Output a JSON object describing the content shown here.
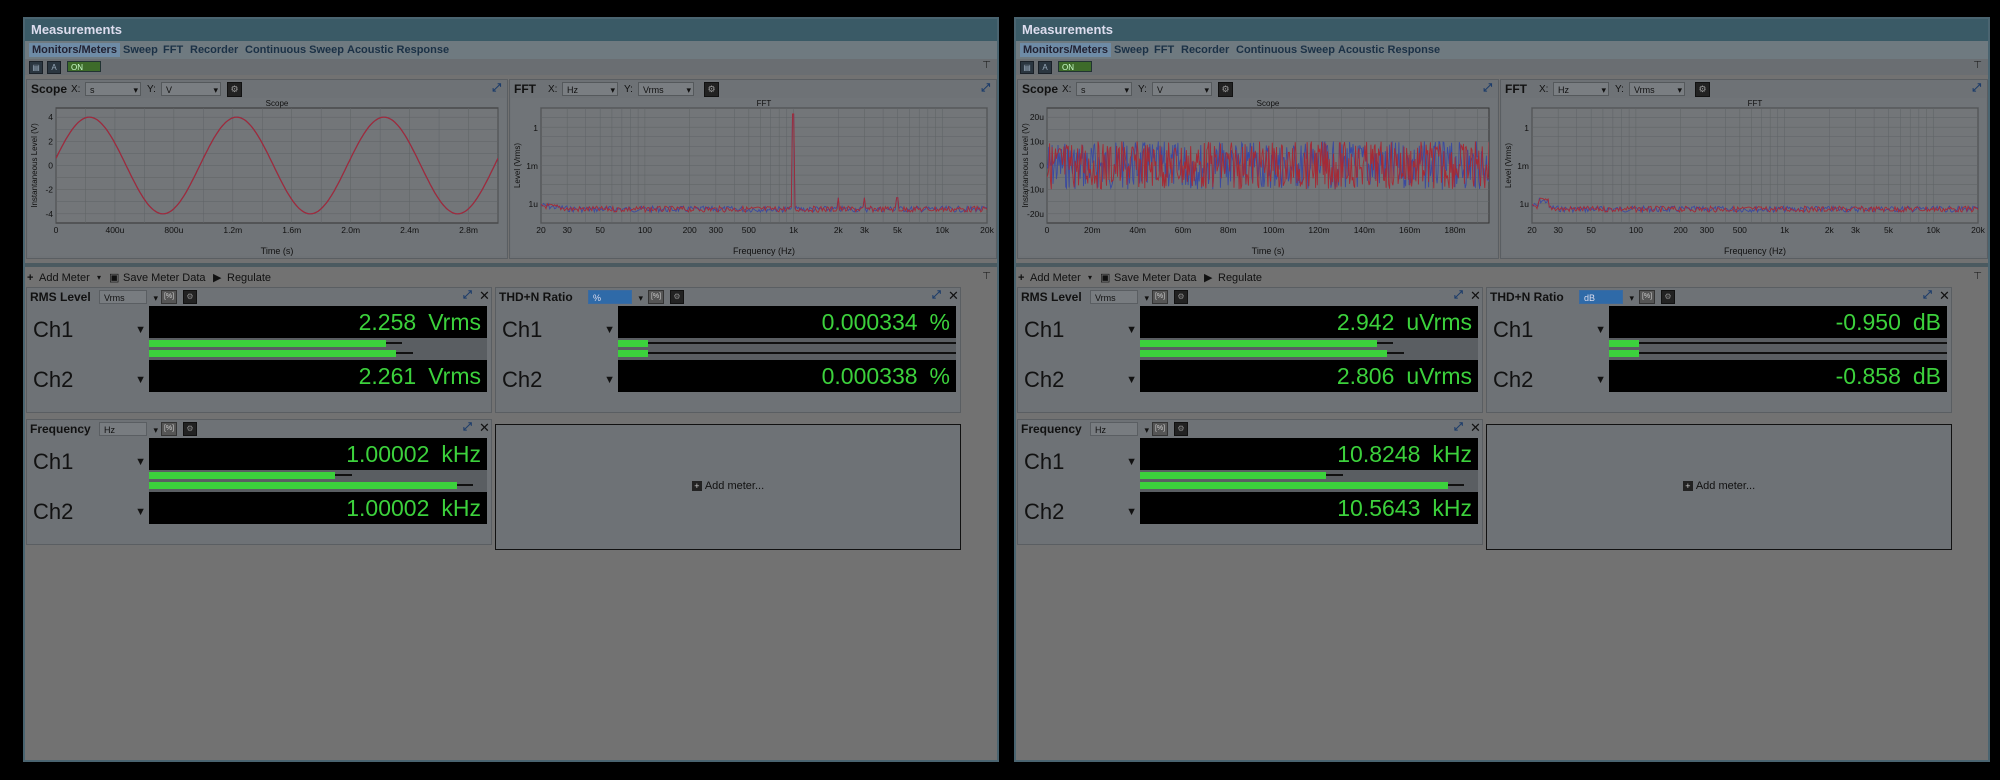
{
  "left": {
    "title": "Measurements",
    "tabs": [
      "Monitors/Meters",
      "Sweep",
      "FFT",
      "Recorder",
      "Continuous Sweep",
      "Acoustic Response"
    ],
    "on_label": "ON",
    "scope": {
      "title": "Scope",
      "x_label": "X:",
      "x_unit": "s",
      "y_label": "Y:",
      "y_unit": "V",
      "chart_title": "Scope",
      "xlabel": "Time (s)",
      "ylabel": "Instantaneous Level (V)",
      "xticks": [
        "0",
        "400u",
        "800u",
        "1.2m",
        "1.6m",
        "2.0m",
        "2.4m",
        "2.8m"
      ],
      "yticks": [
        "4",
        "2",
        "0",
        "-2",
        "-4"
      ]
    },
    "fft": {
      "title": "FFT",
      "x_label": "X:",
      "x_unit": "Hz",
      "y_label": "Y:",
      "y_unit": "Vrms",
      "chart_title": "FFT",
      "xlabel": "Frequency (Hz)",
      "ylabel": "Level (Vrms)",
      "xticks": [
        "20",
        "30",
        "50",
        "100",
        "200",
        "300",
        "500",
        "1k",
        "2k",
        "3k",
        "5k",
        "10k",
        "20k"
      ],
      "yticks": [
        "1",
        "1m",
        "1u"
      ]
    },
    "toolbar": {
      "add_meter": "Add Meter",
      "save_meter_data": "Save Meter Data",
      "regulate": "Regulate"
    },
    "rms": {
      "title": "RMS Level",
      "unit": "Vrms",
      "ch1_label": "Ch1",
      "ch2_label": "Ch2",
      "ch1_value": "2.258",
      "ch2_value": "2.261",
      "ch1_unit": "Vrms",
      "ch2_unit": "Vrms"
    },
    "thd": {
      "title": "THD+N Ratio",
      "unit": "%",
      "ch1_label": "Ch1",
      "ch2_label": "Ch2",
      "ch1_value": "0.000334",
      "ch2_value": "0.000338",
      "ch1_unit": "%",
      "ch2_unit": "%"
    },
    "freq": {
      "title": "Frequency",
      "unit": "Hz",
      "ch1_label": "Ch1",
      "ch2_label": "Ch2",
      "ch1_value": "1.00002",
      "ch2_value": "1.00002",
      "ch1_unit": "kHz",
      "ch2_unit": "kHz"
    },
    "add_meter_label": "Add meter..."
  },
  "right": {
    "title": "Measurements",
    "tabs": [
      "Monitors/Meters",
      "Sweep",
      "FFT",
      "Recorder",
      "Continuous Sweep",
      "Acoustic Response"
    ],
    "on_label": "ON",
    "scope": {
      "title": "Scope",
      "x_label": "X:",
      "x_unit": "s",
      "y_label": "Y:",
      "y_unit": "V",
      "chart_title": "Scope",
      "xlabel": "Time (s)",
      "ylabel": "Instantaneous Level (V)",
      "xticks": [
        "0",
        "20m",
        "40m",
        "60m",
        "80m",
        "100m",
        "120m",
        "140m",
        "160m",
        "180m"
      ],
      "yticks": [
        "20u",
        "10u",
        "0",
        "-10u",
        "-20u"
      ]
    },
    "fft": {
      "title": "FFT",
      "x_label": "X:",
      "x_unit": "Hz",
      "y_label": "Y:",
      "y_unit": "Vrms",
      "chart_title": "FFT",
      "xlabel": "Frequency (Hz)",
      "ylabel": "Level (Vrms)",
      "xticks": [
        "20",
        "30",
        "50",
        "100",
        "200",
        "300",
        "500",
        "1k",
        "2k",
        "3k",
        "5k",
        "10k",
        "20k"
      ],
      "yticks": [
        "1",
        "1m",
        "1u"
      ]
    },
    "toolbar": {
      "add_meter": "Add Meter",
      "save_meter_data": "Save Meter Data",
      "regulate": "Regulate"
    },
    "rms": {
      "title": "RMS Level",
      "unit": "Vrms",
      "ch1_label": "Ch1",
      "ch2_label": "Ch2",
      "ch1_value": "2.942",
      "ch2_value": "2.806",
      "ch1_unit": "uVrms",
      "ch2_unit": "uVrms"
    },
    "thd": {
      "title": "THD+N Ratio",
      "unit": "dB",
      "ch1_label": "Ch1",
      "ch2_label": "Ch2",
      "ch1_value": "-0.950",
      "ch2_value": "-0.858",
      "ch1_unit": "dB",
      "ch2_unit": "dB"
    },
    "freq": {
      "title": "Frequency",
      "unit": "Hz",
      "ch1_label": "Ch1",
      "ch2_label": "Ch2",
      "ch1_value": "10.8248",
      "ch2_value": "10.5643",
      "ch1_unit": "kHz",
      "ch2_unit": "kHz"
    },
    "add_meter_label": "Add meter..."
  }
}
